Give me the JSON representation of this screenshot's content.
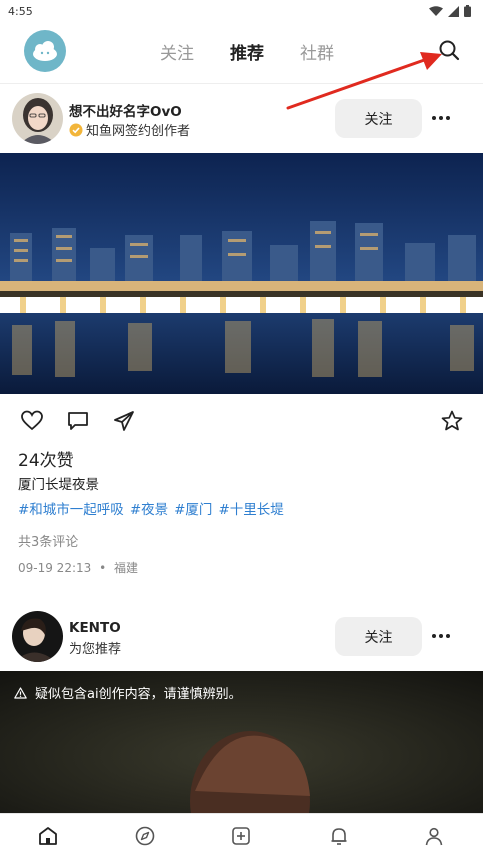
{
  "status_bar": {
    "time": "4:55"
  },
  "header": {
    "tabs": [
      {
        "label": "关注"
      },
      {
        "label": "推荐"
      },
      {
        "label": "社群"
      }
    ]
  },
  "feed": [
    {
      "author": {
        "name": "想不出好名字OvO",
        "subtitle": "知鱼网签约创作者"
      },
      "follow_label": "关注",
      "likes_text": "24次赞",
      "caption": "厦门长堤夜景",
      "tags": [
        "#和城市一起呼吸",
        "#夜景",
        "#厦门",
        "#十里长堤"
      ],
      "comments_text": "共3条评论",
      "timestamp": "09-19 22:13",
      "separator": "•",
      "location": "福建"
    },
    {
      "author": {
        "name": "KENTO",
        "subtitle": "为您推荐"
      },
      "follow_label": "关注",
      "ai_warning": "疑似包含ai创作内容，请谨慎辨别。"
    }
  ],
  "colors": {
    "brand": "#6fb6c8",
    "tag_link": "#2f7fd0",
    "annotation_arrow": "#e02a1f"
  },
  "icons": {
    "statusbar": [
      "wifi-icon",
      "signal-icon",
      "battery-icon"
    ],
    "post_actions": [
      "heart-icon",
      "comment-icon",
      "share-icon",
      "star-icon"
    ],
    "bottom_nav": [
      "home-icon",
      "discover-compass-icon",
      "create-plus-icon",
      "notifications-bell-icon",
      "profile-icon"
    ]
  }
}
